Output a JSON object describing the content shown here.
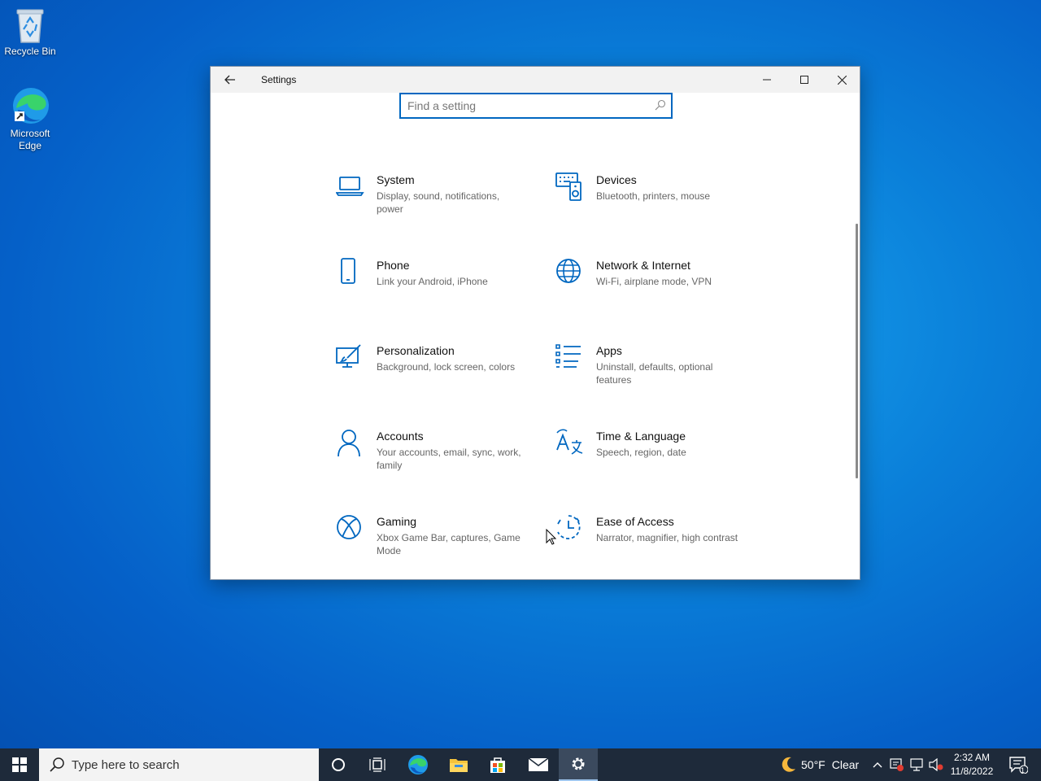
{
  "desktop": {
    "icons": [
      {
        "label": "Recycle Bin"
      },
      {
        "label": "Microsoft Edge"
      }
    ]
  },
  "window": {
    "title": "Settings",
    "search_placeholder": "Find a setting",
    "tiles": [
      {
        "name": "System",
        "desc": "Display, sound, notifications, power",
        "icon": "laptop-icon"
      },
      {
        "name": "Devices",
        "desc": "Bluetooth, printers, mouse",
        "icon": "devices-icon"
      },
      {
        "name": "Phone",
        "desc": "Link your Android, iPhone",
        "icon": "phone-icon"
      },
      {
        "name": "Network & Internet",
        "desc": "Wi-Fi, airplane mode, VPN",
        "icon": "globe-icon"
      },
      {
        "name": "Personalization",
        "desc": "Background, lock screen, colors",
        "icon": "paintbrush-icon"
      },
      {
        "name": "Apps",
        "desc": "Uninstall, defaults, optional features",
        "icon": "apps-list-icon"
      },
      {
        "name": "Accounts",
        "desc": "Your accounts, email, sync, work, family",
        "icon": "person-icon"
      },
      {
        "name": "Time & Language",
        "desc": "Speech, region, date",
        "icon": "time-language-icon"
      },
      {
        "name": "Gaming",
        "desc": "Xbox Game Bar, captures, Game Mode",
        "icon": "xbox-icon"
      },
      {
        "name": "Ease of Access",
        "desc": "Narrator, magnifier, high contrast",
        "icon": "ease-of-access-icon"
      }
    ]
  },
  "taskbar": {
    "search_placeholder": "Type here to search",
    "weather": "50°F",
    "weather_condition": "Clear",
    "time": "2:32 AM",
    "date": "11/8/2022",
    "notification_count": "1"
  },
  "colors": {
    "accent": "#0067c0",
    "taskbar": "#1e2a3a"
  }
}
